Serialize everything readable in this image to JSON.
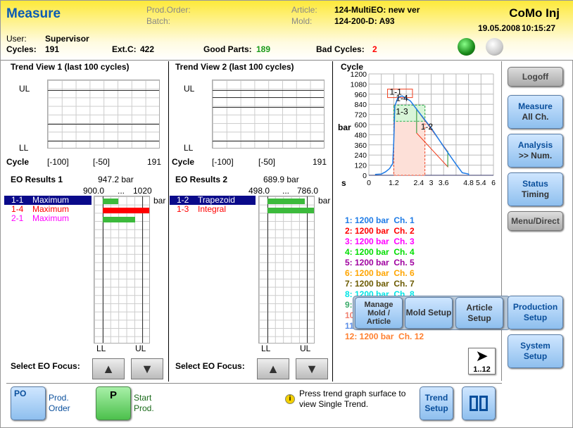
{
  "header": {
    "title": "Measure",
    "prod_order_label": "Prod.Order:",
    "batch_label": "Batch:",
    "article_label": "Article:",
    "article": "124-MultiEO: new ver",
    "mold_label": "Mold:",
    "mold": "124-200-D: A93",
    "app": "CoMo Inj",
    "date": "19.05.2008",
    "time": "10:15:27",
    "user_label": "User:",
    "user": "Supervisor",
    "cycles_label": "Cycles:",
    "cycles": "191",
    "extc_label": "Ext.C:",
    "extc": "422",
    "good_label": "Good Parts:",
    "good": "189",
    "bad_label": "Bad Cycles:",
    "bad": "2",
    "status_lights": [
      "green",
      "gray"
    ]
  },
  "trend1": {
    "title": "Trend View 1 (last 100 cycles)",
    "ul": "UL",
    "ll": "LL",
    "xlabel": "Cycle",
    "ticks": [
      "[-100]",
      "[-50]",
      "191"
    ]
  },
  "trend2": {
    "title": "Trend View 2 (last 100 cycles)",
    "ul": "UL",
    "ll": "LL",
    "xlabel": "Cycle",
    "ticks": [
      "[-100]",
      "[-50]",
      "191"
    ]
  },
  "eo1": {
    "title": "EO Results 1",
    "value": "947.2 bar",
    "min": "900.0",
    "dots": "...",
    "max": "1020",
    "unit": "bar",
    "ll": "LL",
    "ul": "UL",
    "rows": [
      {
        "id": "1-1",
        "name": "Maximum",
        "color": "#ffffff",
        "selected": true,
        "bar_fraction": 0.33,
        "bar_color": "#3cba3c"
      },
      {
        "id": "1-4",
        "name": "Maximum",
        "color": "#ff0000",
        "selected": false,
        "bar_fraction": 1.0,
        "bar_color": "#ff0000"
      },
      {
        "id": "2-1",
        "name": "Maximum",
        "color": "#ff00ff",
        "selected": false,
        "bar_fraction": 0.7,
        "bar_color": "#3cba3c"
      }
    ],
    "focus_label": "Select EO Focus:"
  },
  "eo2": {
    "title": "EO Results 2",
    "value": "689.9 bar",
    "min": "498.0",
    "dots": "...",
    "max": "786.0",
    "unit": "bar",
    "ll": "LL",
    "ul": "UL",
    "rows": [
      {
        "id": "1-2",
        "name": "Trapezoid",
        "color": "#ffffff",
        "selected": true,
        "bar_fraction": 0.8,
        "bar_color": "#3cba3c"
      },
      {
        "id": "1-3",
        "name": "Integral",
        "color": "#ff0000",
        "selected": false,
        "bar_fraction": 1.0,
        "bar_color": "#3cba3c"
      }
    ],
    "focus_label": "Select EO Focus:"
  },
  "cycle_chart": {
    "title": "Cycle",
    "ylabel": "bar",
    "xlabel": "s",
    "yticks": [
      "1200",
      "1080",
      "960",
      "840",
      "720",
      "600",
      "480",
      "360",
      "240",
      "120",
      "0"
    ],
    "xticks": [
      "0",
      "1.2",
      "2.4",
      "3",
      "3.6",
      "4.8",
      "5.4",
      "6"
    ],
    "xlim": [
      0,
      6
    ],
    "ylim": [
      0,
      1200
    ],
    "curve": [
      [
        0.3,
        10
      ],
      [
        0.6,
        15
      ],
      [
        0.8,
        40
      ],
      [
        1.0,
        80
      ],
      [
        1.15,
        140
      ],
      [
        1.2,
        400
      ],
      [
        1.25,
        820
      ],
      [
        1.4,
        920
      ],
      [
        1.6,
        940
      ],
      [
        2.0,
        880
      ],
      [
        2.4,
        750
      ],
      [
        3.0,
        560
      ],
      [
        3.6,
        340
      ],
      [
        4.2,
        130
      ],
      [
        4.5,
        30
      ],
      [
        4.8,
        15
      ],
      [
        4.8,
        0
      ]
    ],
    "curve_color": "#1e7be6",
    "eo_labels": [
      "1-1",
      "1-4",
      "1-3",
      "1-2"
    ]
  },
  "channels": [
    {
      "t": "1: 1200 bar  Ch. 1",
      "c": "#1e7be6"
    },
    {
      "t": "2: 1200 bar  Ch. 2",
      "c": "#ff0000"
    },
    {
      "t": "3: 1200 bar  Ch. 3",
      "c": "#ff00ff"
    },
    {
      "t": "4: 1200 bar  Ch. 4",
      "c": "#00dd00"
    },
    {
      "t": "5: 1200 bar  Ch. 5",
      "c": "#a000a0"
    },
    {
      "t": "6: 1200 bar  Ch. 6",
      "c": "#ffa500"
    },
    {
      "t": "7: 1200 bar  Ch. 7",
      "c": "#6b5a00"
    },
    {
      "t": "8: 1200 bar  Ch. 8",
      "c": "#00e5e5"
    },
    {
      "t": "9:",
      "c": "#3cab6a"
    },
    {
      "t": "10:",
      "c": "#f08070"
    },
    {
      "t": "11:",
      "c": "#5a8ee6"
    },
    {
      "t": "12: 1200 bar  Ch. 12",
      "c": "#ff8030"
    }
  ],
  "page_button": "1..12",
  "popup": {
    "manage": "Manage Mold / Article",
    "mold": "Mold Setup",
    "article": "Article Setup"
  },
  "sidebar": {
    "logoff": "Logoff",
    "measure": "Measure",
    "measure_sub": "All Ch.",
    "analysis": "Analysis",
    "analysis_sub": ">> Num.",
    "status": "Status",
    "status_sub": "Timing",
    "menu": "Menu/Direct",
    "production": "Production Setup",
    "system": "System Setup"
  },
  "footer": {
    "po_icon": "PO",
    "prod_order": "Prod. Order",
    "start_icon": "P",
    "start": "Start Prod.",
    "info": "Press trend graph surface to view Single Trend.",
    "trend_setup": "Trend Setup",
    "layout_icon": "split-view-icon"
  }
}
